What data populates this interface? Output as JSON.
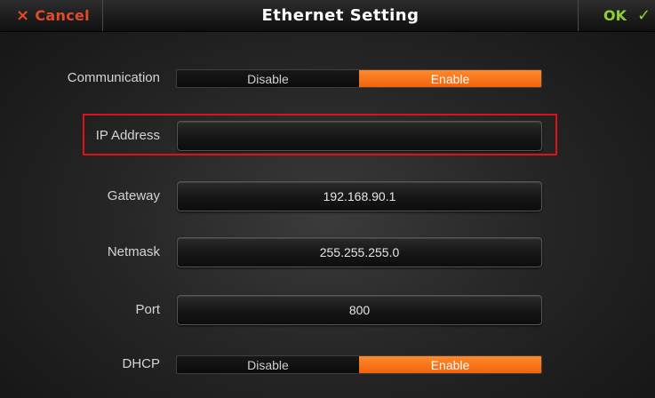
{
  "header": {
    "cancel_icon": "×",
    "cancel_label": "Cancel",
    "title": "Ethernet Setting",
    "ok_label": "OK",
    "ok_icon": "✓"
  },
  "rows": {
    "communication": {
      "label": "Communication",
      "options": [
        "Disable",
        "Enable"
      ],
      "selected": "Enable"
    },
    "ip_address": {
      "label": "IP Address",
      "value": ""
    },
    "gateway": {
      "label": "Gateway",
      "value": "192.168.90.1"
    },
    "netmask": {
      "label": "Netmask",
      "value": "255.255.255.0"
    },
    "port": {
      "label": "Port",
      "value": "800"
    },
    "dhcp": {
      "label": "DHCP",
      "options": [
        "Disable",
        "Enable"
      ],
      "selected": "Enable"
    }
  },
  "colors": {
    "accent_orange": "#f47a1f",
    "cancel_red": "#e24a2a",
    "ok_green": "#8ed032",
    "highlight_red": "#e0101b"
  },
  "icons": {
    "cancel": "close-icon",
    "ok": "check-icon"
  }
}
